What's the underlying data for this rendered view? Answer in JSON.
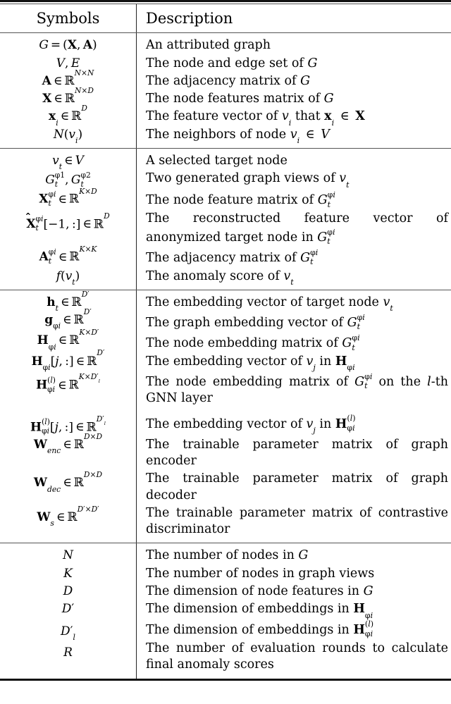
{
  "table": {
    "header": {
      "symbols_label": "Symbols",
      "description_label": "Description"
    },
    "sections": [
      {
        "id": "graph-basics",
        "rows": [
          {
            "symbol_text": "G = (X, A)",
            "description": "An attributed graph"
          },
          {
            "symbol_text": "V, E",
            "description": "The node and edge set of G"
          },
          {
            "symbol_text": "A ∈ R^{N×N}",
            "description": "The adjacency matrix of G"
          },
          {
            "symbol_text": "X ∈ R^{N×D}",
            "description": "The node features matrix of G"
          },
          {
            "symbol_text": "x_i ∈ R^D",
            "description": "The feature vector of v_i that x_i ∈ X"
          },
          {
            "symbol_text": "N(v_i)",
            "description": "The neighbors of node v_i ∈ V"
          }
        ]
      },
      {
        "id": "target-node-views",
        "rows": [
          {
            "symbol_text": "v_t ∈ V",
            "description": "A selected target node"
          },
          {
            "symbol_text": "G_t^{φ1}, G_t^{φ2}",
            "description": "Two generated graph views of v_t"
          },
          {
            "symbol_text": "X_t^{φi} ∈ R^{K×D}",
            "description": "The node feature matrix of G_t^{φi}"
          },
          {
            "symbol_text": "X̂_t^{φi}[−1, :] ∈ R^D",
            "description": "The reconstructed feature vector of anonymized target node in G_t^{φi}"
          },
          {
            "symbol_text": "A_t^{φi} ∈ R^{K×K}",
            "description": "The adjacency matrix of G_t^{φi}"
          },
          {
            "symbol_text": "f(v_t)",
            "description": "The anomaly score of v_t"
          }
        ]
      },
      {
        "id": "embeddings-parameters",
        "rows": [
          {
            "symbol_text": "h_t ∈ R^{D′}",
            "description": "The embedding vector of target node v_t"
          },
          {
            "symbol_text": "g_{φi} ∈ R^{D′}",
            "description": "The graph embedding vector of G_t^{φi}"
          },
          {
            "symbol_text": "H_{φi} ∈ R^{K×D′}",
            "description": "The node embedding matrix of G_t^{φi}"
          },
          {
            "symbol_text": "H_{φi}[j, :] ∈ R^{D′}",
            "description": "The embedding vector of v_j in H_{φi}"
          },
          {
            "symbol_text": "H^{(l)}_{φi} ∈ R^{K×D′_l}",
            "description": "The node embedding matrix of G_t^{φi} on the l-th GNN layer"
          },
          {
            "symbol_text": "H^{(l)}_{φi}[j, :] ∈ R^{D′_l}",
            "description": "The embedding vector of v_j in H^{(l)}_{φi}"
          },
          {
            "symbol_text": "W_{enc} ∈ R^{D×D}",
            "description": "The trainable parameter matrix of graph encoder"
          },
          {
            "symbol_text": "W_{dec} ∈ R^{D×D}",
            "description": "The trainable parameter matrix of graph decoder"
          },
          {
            "symbol_text": "W_s ∈ R^{D′×D′}",
            "description": "The trainable parameter matrix of con­trastive discriminator"
          }
        ]
      },
      {
        "id": "scalars",
        "rows": [
          {
            "symbol_text": "N",
            "description": "The number of nodes in G"
          },
          {
            "symbol_text": "K",
            "description": "The number of nodes in graph views"
          },
          {
            "symbol_text": "D",
            "description": "The dimension of node features in G"
          },
          {
            "symbol_text": "D′",
            "description": "The dimension of embeddings in H_{φi}"
          },
          {
            "symbol_text": "D′_l",
            "description": "The dimension of embeddings in H^{(l)}_{φi}"
          },
          {
            "symbol_text": "R",
            "description": "The number of evaluation rounds to calculate final anomaly scores"
          }
        ]
      }
    ]
  },
  "colors": {
    "text": "#000000",
    "rule_thick": "#111111",
    "rule_thin": "#555555",
    "background": "#ffffff"
  }
}
